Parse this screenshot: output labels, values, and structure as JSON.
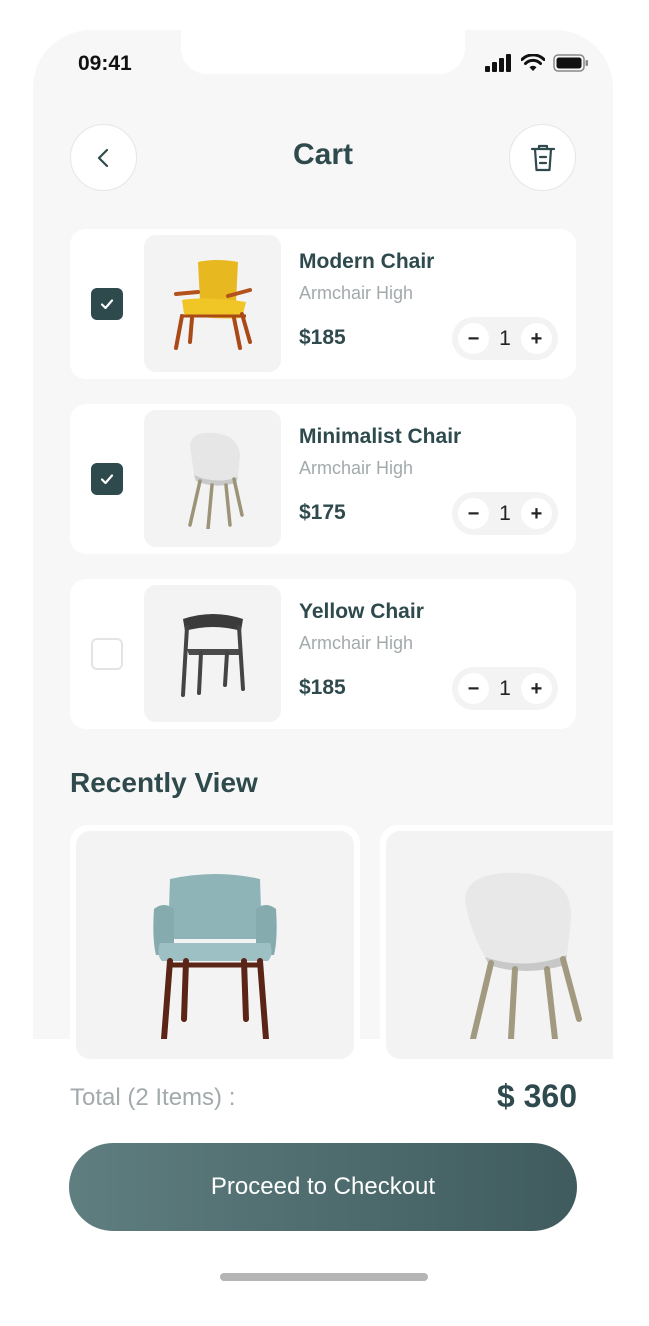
{
  "status_bar": {
    "time": "09:41"
  },
  "header": {
    "title": "Cart"
  },
  "cart_items": [
    {
      "name": "Modern Chair",
      "subtitle": "Armchair High",
      "price": "$185",
      "quantity": "1",
      "checked": true
    },
    {
      "name": "Minimalist Chair",
      "subtitle": "Armchair High",
      "price": "$175",
      "quantity": "1",
      "checked": true
    },
    {
      "name": "Yellow Chair",
      "subtitle": "Armchair High",
      "price": "$185",
      "quantity": "1",
      "checked": false
    }
  ],
  "stepper": {
    "minus": "−",
    "plus": "+"
  },
  "recently_view": {
    "title": "Recently View"
  },
  "summary": {
    "total_label": "Total (2 Items) :",
    "total_value": "$ 360"
  },
  "checkout": {
    "label": "Proceed to Checkout"
  },
  "colors": {
    "primary": "#2f4a4d",
    "muted": "#a3aaab",
    "background": "#f7f7f7"
  },
  "icons": [
    "back-icon",
    "trash-icon",
    "check-icon",
    "signal-icon",
    "wifi-icon",
    "battery-icon"
  ]
}
